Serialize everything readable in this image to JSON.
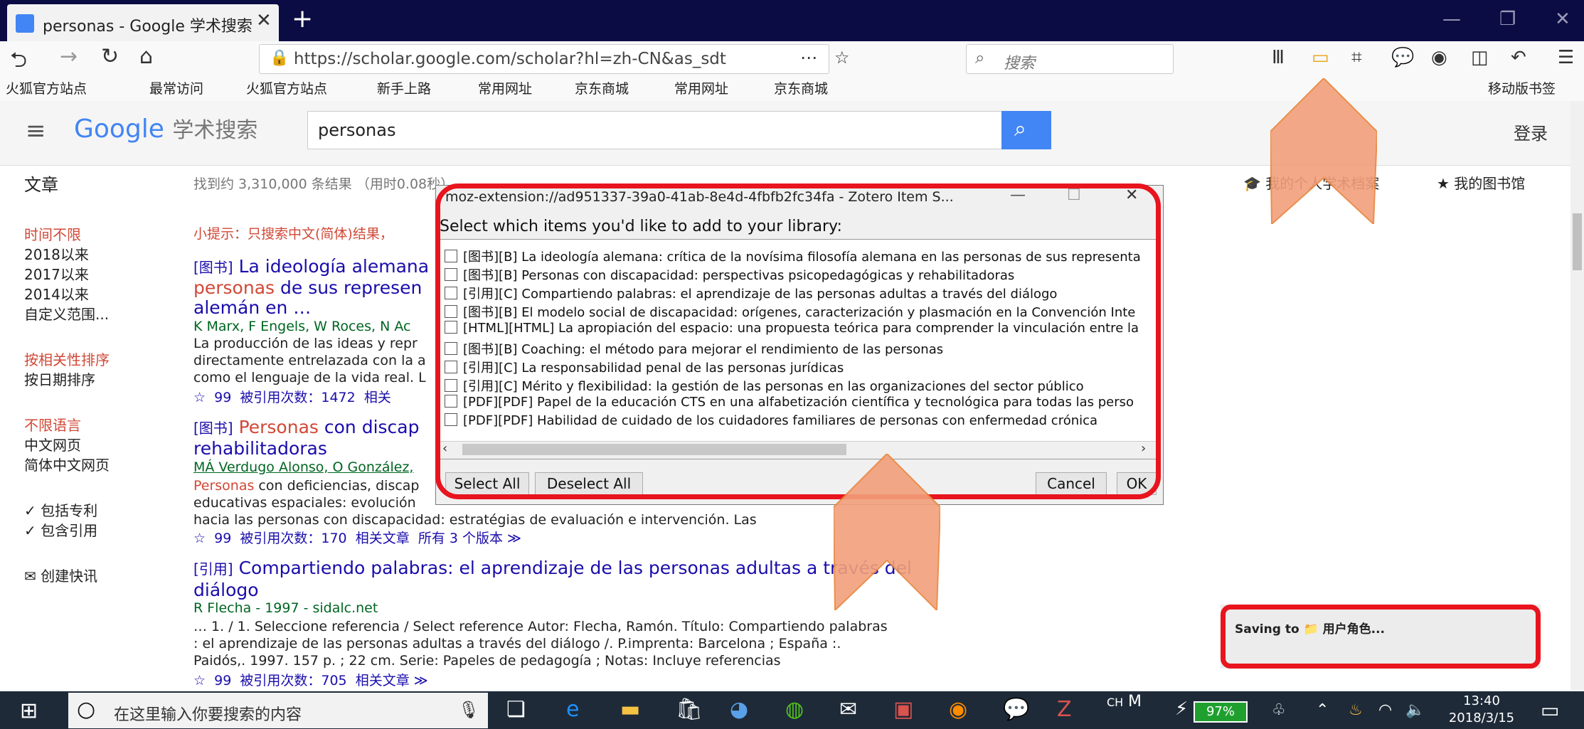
{
  "browser": {
    "tab_title": "personas - Google 学术搜索",
    "url": "https://scholar.google.com/scholar?hl=zh-CN&as_sdt",
    "search_placeholder": "搜索",
    "bookmarks": [
      "火狐官方站点",
      "最常访问",
      "火狐官方站点",
      "新手上路",
      "常用网址",
      "京东商城",
      "常用网址",
      "京东商城"
    ],
    "mobile_bookmarks": "移动版书签"
  },
  "scholar": {
    "logo_google": "Google",
    "logo_scholar": "学术搜索",
    "query": "personas",
    "login": "登录",
    "articles_label": "文章",
    "result_stats": "找到约 3,310,000 条结果 （用时0.08秒）",
    "my_profile": "我的个人学术档案",
    "my_library": "我的图书馆",
    "tip": "小提示：只搜索中文(简体)结果，",
    "sidebar": {
      "time": [
        "时间不限",
        "2018以来",
        "2017以来",
        "2014以来",
        "自定义范围..."
      ],
      "sort": [
        "按相关性排序",
        "按日期排序"
      ],
      "lang": [
        "不限语言",
        "中文网页",
        "简体中文网页"
      ],
      "include_patents": "包括专利",
      "include_citations": "包含引用",
      "create_alert": "创建快讯"
    },
    "results": [
      {
        "tag": "[图书]",
        "title_l1": "La ideología alemana",
        "title_l2_hl": "personas",
        "title_l2": " de sus represen",
        "title_l3": "alemán en …",
        "author": "K Marx, F Engels, W Roces, N Ac",
        "snippet": [
          "La producción de las ideas y repr",
          "directamente entrelazada con la a",
          "como el lenguaje de la vida real. L"
        ],
        "cited": "被引用次数：1472",
        "related": "相关"
      },
      {
        "tag": "[图书]",
        "title_hl": "Personas",
        "title": " con discap",
        "title_l2": "rehabilitadoras",
        "author": "MÁ Verdugo Alonso, O González,",
        "snippet_hl": "Personas",
        "snippet": [
          " con deficiencias, discap",
          "educativas espaciales: evolución",
          "hacia las personas con discapacidad: estratégias de evaluación e intervención. Las"
        ],
        "cited": "被引用次数：170",
        "related": "相关文章",
        "versions": "所有 3 个版本"
      },
      {
        "tag": "[引用]",
        "title": "Compartiendo palabras: el aprendizaje de las personas adultas a través del diálogo",
        "author": "R Flecha - 1997 - sidalc.net",
        "snippet": [
          "… 1. / 1. Seleccione referencia / Select reference Autor: Flecha, Ramón. Título: Compartiendo palabras",
          ": el aprendizaje de las personas adultas a través del diálogo /. P.imprenta: Barcelona ; España :.",
          "Paidós,. 1997. 157 p. ; 22 cm. Serie: Papeles de pedagogía ; Notas: Incluye referencias"
        ],
        "cited": "被引用次数：705",
        "related": "相关文章"
      }
    ]
  },
  "dialog": {
    "title": "moz-extension://ad951337-39a0-41ab-8e4d-4fbfb2fc34fa - Zotero Item S...",
    "prompt": "Select which items you'd like to add to your library:",
    "items": [
      "[图书][B] La ideología alemana: crítica de la novísima filosofía alemana en las personas de sus representa",
      "[图书][B] Personas con discapacidad: perspectivas psicopedagógicas y rehabilitadoras",
      "[引用][C] Compartiendo palabras: el aprendizaje de las personas adultas a través del diálogo",
      "[图书][B] El modelo social de discapacidad: orígenes, caracterización y plasmación en la Convención Inte",
      "[HTML][HTML] La apropiación del espacio: una propuesta teórica para comprender la vinculación entre la",
      "[图书][B] Coaching: el método para mejorar el rendimiento de las personas",
      "[引用][C] La responsabilidad penal de las personas jurídicas",
      "[引用][C] Mérito y flexibilidad: la gestión de las personas en las organizaciones del sector público",
      "[PDF][PDF] Papel de la educación CTS en una alfabetización científica y tecnológica para todas las perso",
      "[PDF][PDF] Habilidad de cuidado de los cuidadores familiares de personas con enfermedad crónica"
    ],
    "select_all": "Select All",
    "deselect_all": "Deselect All",
    "cancel": "Cancel",
    "ok": "OK"
  },
  "zotero_saving": "Saving to 📁 用户角色...",
  "taskbar": {
    "search_placeholder": "在这里输入你要搜索的内容",
    "ime": "CH",
    "battery": "97%",
    "time": "13:40",
    "date": "2018/3/15"
  },
  "colors": {
    "annotation_red": "#e8141e",
    "arrow_fill": "#f2a07b",
    "google_blue": "#4285f4",
    "link": "#1a0dab",
    "highlight": "#d14836"
  }
}
